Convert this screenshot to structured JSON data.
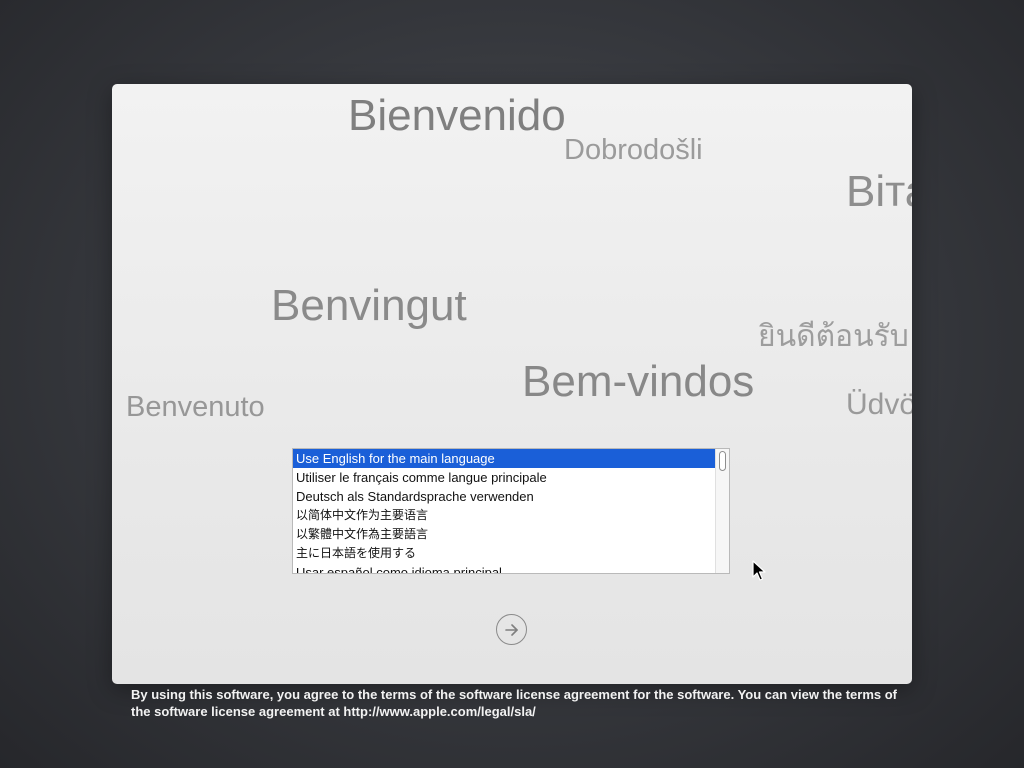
{
  "welcome_words": {
    "bienvenido": "Bienvenido",
    "dobrodosli": "Dobrodošli",
    "bit": "Вітаємо",
    "benvingut": "Benvingut",
    "thai": "ยินดีต้อนรับ",
    "bemvindos": "Bem-vindos",
    "benvenuto": "Benvenuto",
    "udv": "Üdvözöljük"
  },
  "languages": [
    "Use English for the main language",
    "Utiliser le français comme langue principale",
    "Deutsch als Standardsprache verwenden",
    "以简体中文作为主要语言",
    "以繁體中文作為主要語言",
    "主に日本語を使用する",
    "Usar español como idioma principal"
  ],
  "selected_language": "Use English for the main language",
  "icons": {
    "continue": "arrow-right-circle-icon",
    "cursor": "mouse-pointer-icon"
  },
  "license": {
    "text": "By using this software, you agree to the terms of the software license agreement for the software. You can view the terms of the software license agreement at http://www.apple.com/legal/sla/"
  },
  "colors": {
    "selection": "#1a5fd8",
    "panel": "#ececec",
    "background": "#35373c"
  }
}
